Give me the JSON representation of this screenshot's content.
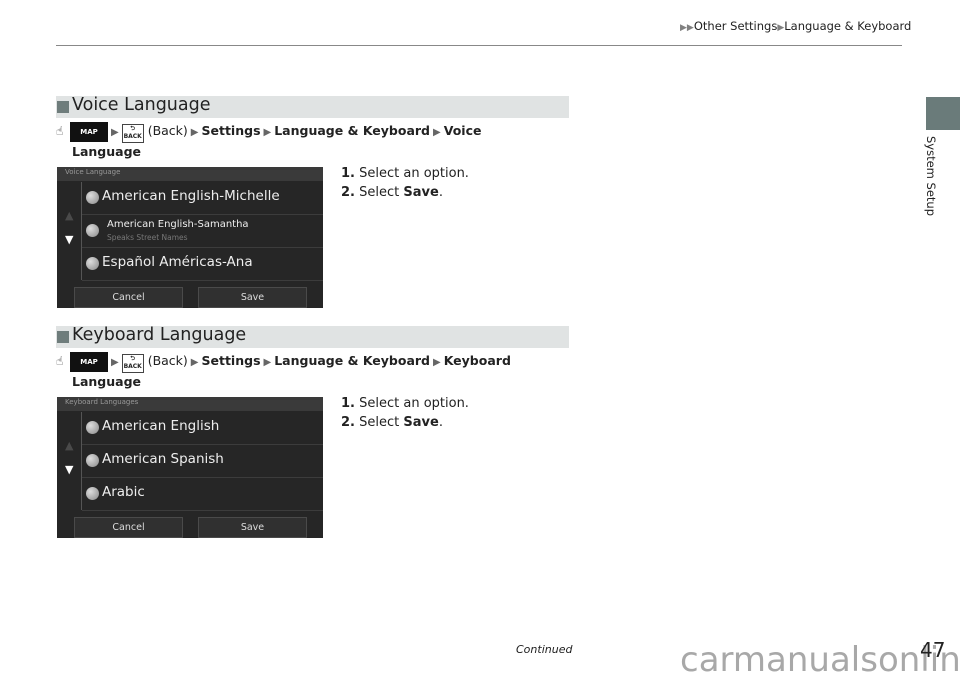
{
  "header": {
    "breadcrumb": [
      "Other Settings",
      "Language & Keyboard"
    ]
  },
  "side_tab": {
    "label": "System Setup",
    "color": "#6a7b7a"
  },
  "sections": [
    {
      "title": "Voice Language",
      "path": {
        "map_label": "MAP",
        "back_label": "BACK",
        "back_text": "(Back)",
        "steps": [
          "Settings",
          "Language & Keyboard",
          "Voice"
        ],
        "last_line": "Language"
      },
      "instructions": {
        "step1_num": "1.",
        "step1_text": "Select an option.",
        "step2_num": "2.",
        "step2_text": "Select ",
        "step2_bold": "Save",
        "step2_end": "."
      },
      "screen": {
        "title": "Voice Language",
        "options": [
          {
            "label": "American English-Michelle"
          },
          {
            "label": "American English-Samantha",
            "sub": "Speaks Street Names"
          },
          {
            "label": "Español Américas-Ana"
          }
        ],
        "cancel": "Cancel",
        "save": "Save"
      }
    },
    {
      "title": "Keyboard Language",
      "path": {
        "map_label": "MAP",
        "back_label": "BACK",
        "back_text": "(Back)",
        "steps": [
          "Settings",
          "Language & Keyboard",
          "Keyboard"
        ],
        "last_line": "Language"
      },
      "instructions": {
        "step1_num": "1.",
        "step1_text": "Select an option.",
        "step2_num": "2.",
        "step2_text": "Select ",
        "step2_bold": "Save",
        "step2_end": "."
      },
      "screen": {
        "title": "Keyboard Languages",
        "options": [
          {
            "label": "American English"
          },
          {
            "label": "American Spanish"
          },
          {
            "label": "Arabic"
          }
        ],
        "cancel": "Cancel",
        "save": "Save"
      }
    }
  ],
  "footer": {
    "continued": "Continued",
    "page_number": "47",
    "watermark": "carmanualsonline.info"
  }
}
